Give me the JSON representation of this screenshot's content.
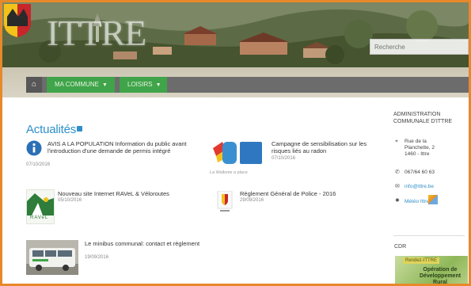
{
  "header": {
    "site_name": "ITTRE",
    "search_placeholder": "Recherche"
  },
  "nav": {
    "home_icon": "home-icon",
    "tabs": [
      {
        "label": "MA COMMUNE",
        "caret": "▼"
      },
      {
        "label": "LOISIRS",
        "caret": "▼"
      }
    ]
  },
  "news": {
    "section_title": "Actualités",
    "items": [
      {
        "title": "AVIS A LA POPULATION Information du public avant l'introduction d'une demande de permis intégré",
        "date": "07/10/2016"
      },
      {
        "title": "Campagne de sensibilisation sur les risques liés au radon",
        "date": "07/10/2016",
        "thumb_caption": "La Wallonie a place"
      },
      {
        "title": "Nouveau site Internet RAVeL & Véloroutes",
        "date": "05/10/2016",
        "thumb_caption": "RAVeL"
      },
      {
        "title": "Règlement Général de Police - 2016",
        "date": "29/09/2016"
      },
      {
        "title": "Le minibus communal: contact et règlement",
        "date": "19/09/2016"
      }
    ]
  },
  "sidebar": {
    "admin_title": "ADMINISTRATION COMMUNALE D'ITTRE",
    "address_lines": [
      "Rue de la",
      "Planchette, 2",
      "1460 - Ittre"
    ],
    "phone": "067/64 60 63",
    "email": "info@ittre.be",
    "weather_link": "Météo Ittre",
    "cdr_title": "CDR",
    "cdr_tag": "Rendez-ITTRE",
    "cdr_text": "Opération de Développement Rural"
  },
  "colors": {
    "accent_green": "#3fa44a",
    "title_blue": "#2f8fc9",
    "frame_orange": "#e7892a",
    "nav_gray": "#6c6c6c"
  }
}
